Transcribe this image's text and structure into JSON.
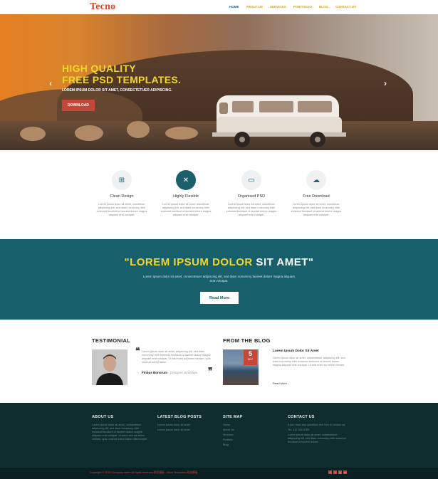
{
  "header": {
    "logo": "Tecno",
    "nav": [
      {
        "label": "HOME",
        "active": true
      },
      {
        "label": "ABOUT US",
        "active": false
      },
      {
        "label": "SERVICES",
        "active": false
      },
      {
        "label": "PORTFOLIO",
        "active": false
      },
      {
        "label": "BLOG",
        "active": false
      },
      {
        "label": "CONTACT US",
        "active": false
      }
    ]
  },
  "hero": {
    "title_line1": "HIGH QUALITY",
    "title_line2": "FREE PSD TEMPLATES.",
    "subtitle": "LOREM IPSUM DOLOR SIT AMET, CONSECTETUER ADIPISCING.",
    "button": "DOWNLOAD",
    "prev_icon": "chevron-left-icon",
    "next_icon": "chevron-right-icon"
  },
  "features": [
    {
      "icon": "windows-icon",
      "title": "Clean Design",
      "text": "Lorem ipsum dolor sit amet, nsectetuer adipiscing elit, sed diam nonummy nibh euismod tincidunt ut laoreet dolore magna aliquam erat volutpat."
    },
    {
      "icon": "arrows-expand-icon",
      "title": "Highly Flexible",
      "text": "Lorem ipsum dolor sit amet, nsectetuer adipiscing elit, sed diam nonummy nibh euismod tincidunt ut laoreet dolore magna aliquam erat volutpat."
    },
    {
      "icon": "folder-icon",
      "title": "Organised PSD",
      "text": "Lorem ipsum dolor sit amet, nsectetuer adipiscing elit, sed diam nonummy nibh euismod tincidunt ut laoreet dolore magna aliquam erat volutpat."
    },
    {
      "icon": "cloud-download-icon",
      "title": "Free Download",
      "text": "Lorem ipsum dolor sit amet, nsectetuer adipiscing elit, sed diam nonummy nibh euismod tincidunt ut laoreet dolore magna aliquam erat volutpat."
    }
  ],
  "banner": {
    "title_part1": "\"LOREM IPSUM DOLOR",
    "title_part2": " SIT AMET\"",
    "text": "Lorem ipsum dolor sit amet, consectetuer adipiscing elit, sed diam nonummy laoreet dolore magna aliquam erat volutpat.",
    "button": "Read More"
  },
  "testimonial": {
    "heading": "TESTIMONIAL",
    "text": "Lorem ipsum dolor sit amet, adipiscing elit, sed diam nonummy nibh euismod tincidunt ut laoreet dolore magna aliquam erat volutpat. Ut wisi enim ad minim veniam, quis nostrud exerci tation.",
    "name": "Finbus Bonorum",
    "role": "- Designer at Wasps"
  },
  "blog": {
    "heading": "FROM THE BLOG",
    "date_day": "5",
    "date_month": "DEC",
    "title": "Lorem Ipsum Dolor Sit Amet",
    "text": "Lorem ipsum dolor sit amet, consectetuer adipiscing elit, sed diam nonummy nibh euismod tincidunt ut laoreet dolore magna aliquam erat volutpat. Ut wisi enim ad minim veniam.",
    "read_more": "Read More..."
  },
  "footer": {
    "about": {
      "heading": "ABOUT US",
      "text": "Lorem ipsum dolor sit amet, consectetuer adipiscing elit, sed diam nonummy nibh euismod tincidunt ut laoreet dolore magna aliquam erat volutpat. Ut wisi enim ad minim veniam, quis nostrud exerci tation ullamcorper."
    },
    "posts": {
      "heading": "LATEST BLOG POSTS",
      "items": [
        "Lorem ipsum dolor sit amet",
        "Lorem ipsum dolor sit amet"
      ]
    },
    "sitemap": {
      "heading": "SITE MAP",
      "items": [
        "Home",
        "About Us",
        "Services",
        "Portfolio",
        "Blog"
      ]
    },
    "contact": {
      "heading": "CONTACT US",
      "lines": [
        "If you have any questions feel free to contact us.",
        "Tel: 012 345 6789",
        "Lorem ipsum dolor sit amet, consectetuer adipiscing elit, sed diam nonummy nibh euismod tincidunt ut laoreet dolore."
      ]
    }
  },
  "bottom": {
    "copyright": "Copyright © 2015 Company name All rights reserved.网页模板 - More Templates 网站模板",
    "social": [
      "f",
      "t",
      "g",
      "in"
    ]
  },
  "colors": {
    "accent_teal": "#175f6a",
    "accent_red": "#c4473a",
    "accent_yellow": "#f2d630",
    "footer_dark": "#0f2c2f"
  }
}
